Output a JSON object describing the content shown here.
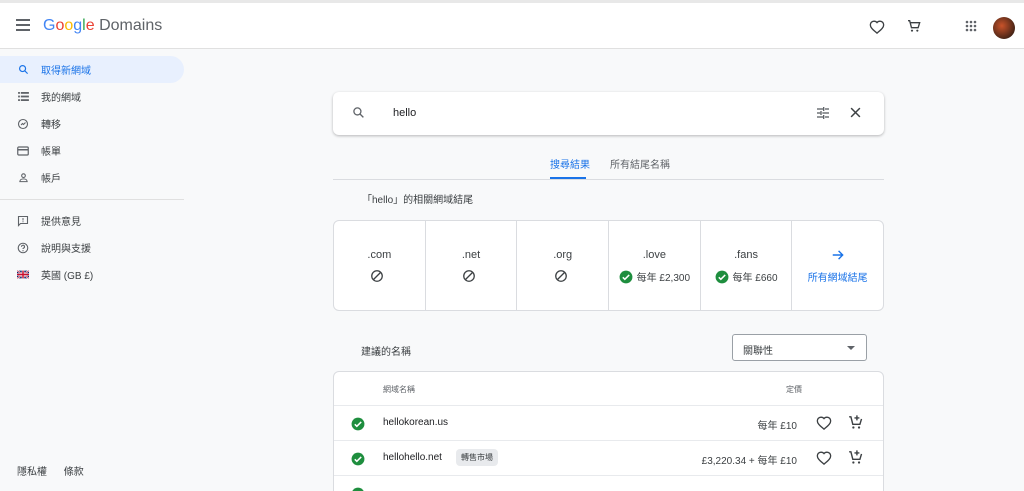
{
  "header": {
    "logo_google": [
      "G",
      "o",
      "o",
      "g",
      "l",
      "e"
    ],
    "logo_product": "Domains"
  },
  "sidebar": {
    "items": [
      {
        "label": "取得新網域"
      },
      {
        "label": "我的網域"
      },
      {
        "label": "轉移"
      },
      {
        "label": "帳單"
      },
      {
        "label": "帳戶"
      },
      {
        "label": "提供意見"
      },
      {
        "label": "說明與支援"
      },
      {
        "label": "英國 (GB £)"
      }
    ],
    "footer": {
      "privacy": "隱私權",
      "terms": "條款"
    }
  },
  "search": {
    "value": "hello"
  },
  "tabs": [
    {
      "label": "搜尋結果"
    },
    {
      "label": "所有結尾名稱"
    }
  ],
  "endings": {
    "title": "「hello」的相關網域結尾",
    "items": [
      {
        "tld": ".com",
        "status": ""
      },
      {
        "tld": ".net",
        "status": ""
      },
      {
        "tld": ".org",
        "status": ""
      },
      {
        "tld": ".love",
        "status": "每年 £2,300"
      },
      {
        "tld": ".fans",
        "status": "每年 £660"
      }
    ],
    "all_label": "所有網域結尾"
  },
  "suggestions": {
    "title": "建議的名稱",
    "sort_value": "關聯性",
    "col_domain": "網域名稱",
    "col_price": "定價",
    "rows": [
      {
        "name": "hellokorean.us",
        "badge": "",
        "price": "每年 £10"
      },
      {
        "name": "hellohello.net",
        "badge": "轉售市場",
        "price": "£3,220.34 + 每年 £10"
      }
    ]
  },
  "colors": {
    "accent": "#1a73e8",
    "available": "#1e8e3e",
    "active_bg": "#e8f0fe"
  }
}
